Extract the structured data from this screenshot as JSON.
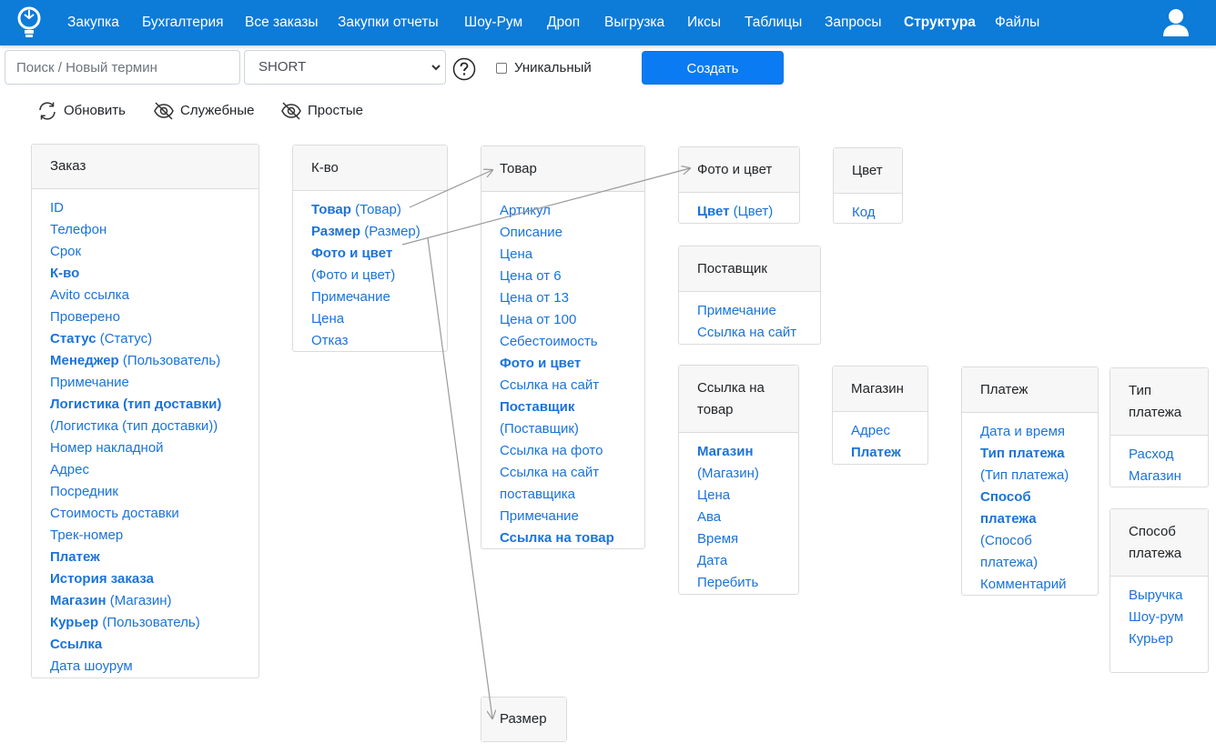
{
  "nav": {
    "items": [
      "Закупка",
      "Бухгалтерия",
      "Все заказы",
      "Закупки отчеты",
      "Шоу-Рум",
      "Дроп",
      "Выгрузка",
      "Иксы",
      "Таблицы",
      "Запросы",
      "Структура",
      "Файлы"
    ],
    "active": "Структура"
  },
  "toolbar": {
    "search_placeholder": "Поиск / Новый термин",
    "select_value": "SHORT",
    "unique_label": "Уникальный",
    "create_label": "Создать",
    "refresh_label": "Обновить",
    "service_label": "Служебные",
    "simple_label": "Простые"
  },
  "colors": {
    "navbar": "#0d7bd8",
    "link": "#1a73d9",
    "button": "#0a7bf2"
  },
  "cards": [
    {
      "title": "Заказ",
      "fields": [
        {
          "text": "ID"
        },
        {
          "text": "Телефон"
        },
        {
          "text": "Срок"
        },
        {
          "bold": "К-во"
        },
        {
          "text": "Avito ссылка"
        },
        {
          "text": "Проверено"
        },
        {
          "bold": "Статус",
          "ref": "(Статус)"
        },
        {
          "bold": "Менеджер",
          "ref": "(Пользователь)"
        },
        {
          "text": "Примечание"
        },
        {
          "bold": "Логистика (тип доставки)",
          "ref": "(Логистика (тип доставки))"
        },
        {
          "text": "Номер накладной"
        },
        {
          "text": "Адрес"
        },
        {
          "text": "Посредник"
        },
        {
          "text": "Стоимость доставки"
        },
        {
          "text": "Трек-номер"
        },
        {
          "bold": "Платеж"
        },
        {
          "bold": "История заказа"
        },
        {
          "bold": "Магазин",
          "ref": "(Магазин)"
        },
        {
          "bold": "Курьер",
          "ref": "(Пользователь)"
        },
        {
          "bold": "Ссылка"
        },
        {
          "text": "Дата шоурум"
        }
      ]
    },
    {
      "title": "К-во",
      "fields": [
        {
          "bold": "Товар",
          "ref": "(Товар)"
        },
        {
          "bold": "Размер",
          "ref": "(Размер)"
        },
        {
          "bold": "Фото и цвет",
          "ref": "(Фото и цвет)"
        },
        {
          "text": "Примечание"
        },
        {
          "text": "Цена"
        },
        {
          "text": "Отказ"
        }
      ]
    },
    {
      "title": "Товар",
      "fields": [
        {
          "text": "Артикул"
        },
        {
          "text": "Описание"
        },
        {
          "text": "Цена"
        },
        {
          "text": "Цена от 6"
        },
        {
          "text": "Цена от 13"
        },
        {
          "text": "Цена от 100"
        },
        {
          "text": "Себестоимость"
        },
        {
          "bold": "Фото и цвет"
        },
        {
          "text": "Ссылка на сайт"
        },
        {
          "bold": "Поставщик",
          "ref": "(Поставщик)"
        },
        {
          "text": "Ссылка на фото"
        },
        {
          "text": "Ссылка на сайт поставщика"
        },
        {
          "text": "Примечание"
        },
        {
          "bold": "Ссылка на товар"
        }
      ]
    },
    {
      "title": "Фото и цвет",
      "fields": [
        {
          "bold": "Цвет",
          "ref": "(Цвет)"
        }
      ]
    },
    {
      "title": "Цвет",
      "fields": [
        {
          "text": "Код"
        }
      ]
    },
    {
      "title": "Поставщик",
      "fields": [
        {
          "text": "Примечание"
        },
        {
          "text": "Ссылка на сайт"
        }
      ]
    },
    {
      "title": "Ссылка на товар",
      "fields": [
        {
          "bold": "Магазин",
          "ref": "(Магазин)"
        },
        {
          "text": "Цена"
        },
        {
          "text": "Ава"
        },
        {
          "text": "Время"
        },
        {
          "text": "Дата"
        },
        {
          "text": "Перебить"
        }
      ]
    },
    {
      "title": "Магазин",
      "fields": [
        {
          "text": "Адрес"
        },
        {
          "bold": "Платеж"
        }
      ]
    },
    {
      "title": "Платеж",
      "fields": [
        {
          "text": "Дата и время"
        },
        {
          "bold": "Тип платежа",
          "ref": "(Тип платежа)"
        },
        {
          "bold": "Способ платежа",
          "ref": "(Способ платежа)"
        },
        {
          "text": "Комментарий"
        }
      ]
    },
    {
      "title": "Тип платежа",
      "fields": [
        {
          "text": "Расход"
        },
        {
          "text": "Магазин"
        }
      ]
    },
    {
      "title": "Способ платежа",
      "fields": [
        {
          "text": "Выручка"
        },
        {
          "text": "Шоу-рум"
        },
        {
          "text": "Курьер"
        }
      ]
    },
    {
      "title": "Размер",
      "fields": []
    }
  ]
}
